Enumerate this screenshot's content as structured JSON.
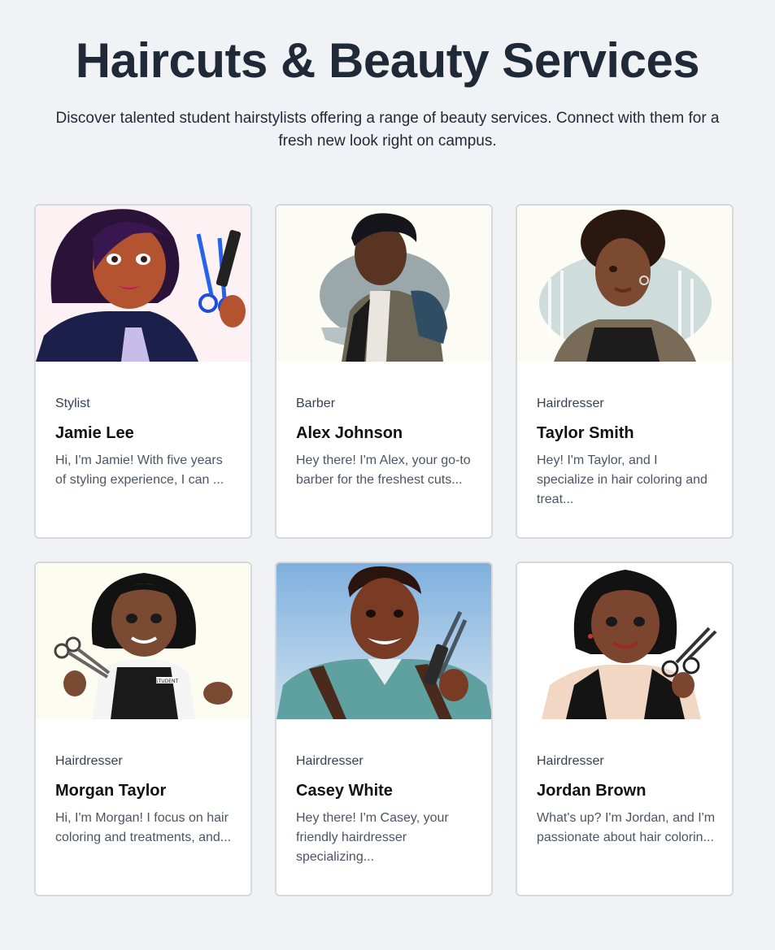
{
  "header": {
    "title": "Haircuts & Beauty Services",
    "subtitle": "Discover talented student hairstylists offering a range of beauty services. Connect with them for a fresh new look right on campus."
  },
  "stylists": [
    {
      "role": "Stylist",
      "name": "Jamie Lee",
      "bio": "Hi, I'm Jamie! With five years of styling experience, I can ...",
      "photo_icon": "stylist-portrait-icon"
    },
    {
      "role": "Barber",
      "name": "Alex Johnson",
      "bio": "Hey there! I'm Alex, your go-to barber for the freshest cuts...",
      "photo_icon": "barber-portrait-icon"
    },
    {
      "role": "Hairdresser",
      "name": "Taylor Smith",
      "bio": "Hey! I'm Taylor, and I specialize in hair coloring and treat...",
      "photo_icon": "hairdresser-portrait-icon"
    },
    {
      "role": "Hairdresser",
      "name": "Morgan Taylor",
      "bio": "Hi, I'm Morgan! I focus on hair coloring and treatments, and...",
      "photo_icon": "hairdresser-portrait-icon",
      "apron_badge": "STUDENT"
    },
    {
      "role": "Hairdresser",
      "name": "Casey White",
      "bio": "Hey there! I'm Casey, your friendly hairdresser specializing...",
      "photo_icon": "hairdresser-portrait-icon"
    },
    {
      "role": "Hairdresser",
      "name": "Jordan Brown",
      "bio": "What's up? I'm Jordan, and I'm passionate about hair colorin...",
      "photo_icon": "hairdresser-portrait-icon"
    }
  ],
  "colors": {
    "page_background": "#f0f2f5",
    "card_background": "#ffffff",
    "card_border": "#d5d9de",
    "heading": "#1f2937"
  }
}
